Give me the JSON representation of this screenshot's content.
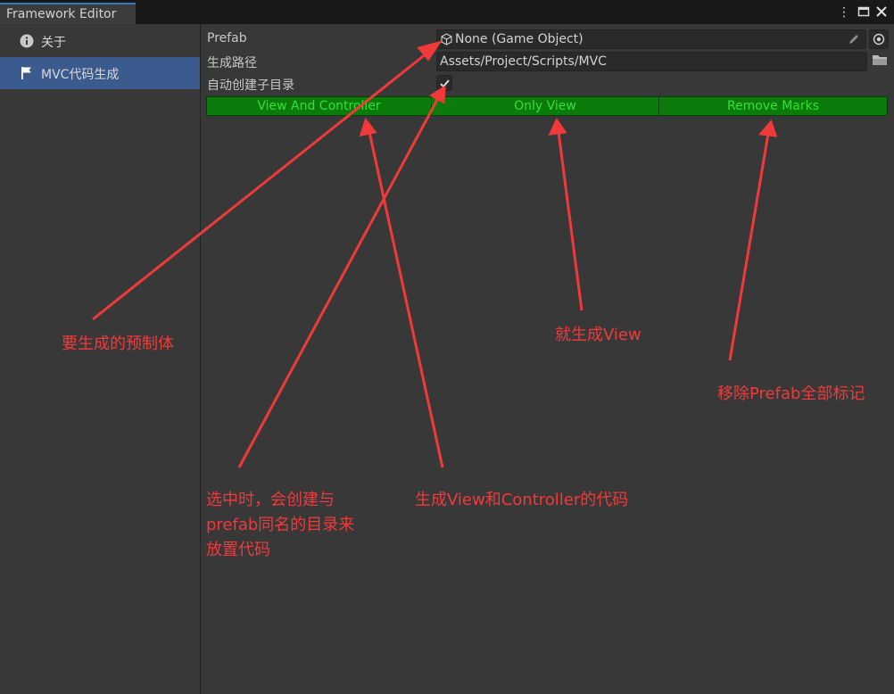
{
  "window": {
    "title": "Framework Editor",
    "menu_icon": "⋮",
    "maximize_icon": "▭",
    "close_icon": "✕"
  },
  "sidebar": {
    "items": [
      {
        "label": "关于",
        "icon": "info-icon",
        "active": false
      },
      {
        "label": "MVC代码生成",
        "icon": "flag-icon",
        "active": true
      }
    ]
  },
  "form": {
    "prefab_label": "Prefab",
    "prefab_value": "None (Game Object)",
    "path_label": "生成路径",
    "path_value": "Assets/Project/Scripts/MVC",
    "subdir_label": "自动创建子目录",
    "subdir_checked": true
  },
  "buttons": {
    "view_and_controller": "View And Controller",
    "only_view": "Only View",
    "remove_marks": "Remove Marks"
  },
  "annotations": {
    "prefab_note": "要生成的预制体",
    "subdir_note_1": "选中时，会创建与",
    "subdir_note_2": "prefab同名的目录来",
    "subdir_note_3": "放置代码",
    "vc_note": "生成View和Controller的代码",
    "view_note": "就生成View",
    "remove_note": "移除Prefab全部标记"
  },
  "colors": {
    "accent": "#3b5a8e",
    "button_green": "#0b7b0b",
    "button_text": "#35e035",
    "annotation_red": "#f03a3a"
  }
}
